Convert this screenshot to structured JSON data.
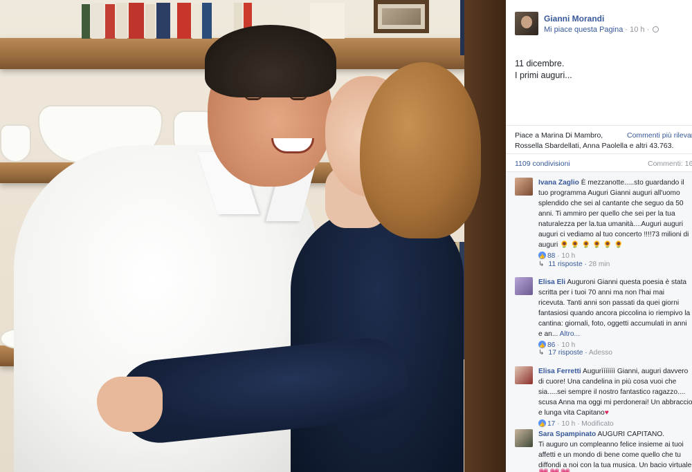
{
  "post": {
    "page_name": "Gianni Morandi",
    "like_page": "Mi piace questa Pagina",
    "time": "10 h",
    "separator": " · ",
    "text_line1": "11 dicembre.",
    "text_line2": "I primi auguri..."
  },
  "likes": {
    "line1": "Piace a Marina Di Mambro,",
    "line2": "Rossella Sbardellati, Anna Paolella e altri 43.763.",
    "top_comments": "Commenti più rilevanti"
  },
  "shares": {
    "count": "1109 condivisioni",
    "comments": "Commenti: 16"
  },
  "comments": [
    {
      "name": "Ivana Zaglio",
      "lines": [
        "È mezzanotte.....sto guardando il",
        "tuo programma Auguri Gianni auguri all'uomo",
        "splendido che sei al cantante che seguo da 50",
        "anni. Ti ammiro per quello che sei per la tua",
        "naturalezza per la.tua umanità....Auguri auguri",
        "auguri ci vediamo al tuo concerto !!!!73 milioni di",
        "auguri"
      ],
      "emoji": "🌻🌻🌻🌻🌻🌻",
      "likes": "88",
      "time": "10 h",
      "replies": "11 risposte",
      "replies_ago": "28 min"
    },
    {
      "name": "Elisa Eli",
      "lines": [
        "Auguroni Gianni questa poesia è stata",
        "scritta per i tuoi 70 anni ma non l'hai mai",
        "ricevuta. Tanti anni son passati da quei giorni",
        "fantasiosi quando ancora piccolina io riempivo la",
        "cantina: giornali, foto, oggetti accumulati in anni",
        "e an..."
      ],
      "more": "Altro...",
      "likes": "86",
      "time": "10 h",
      "replies": "17 risposte",
      "replies_ago": "Adesso"
    },
    {
      "name": "Elisa Ferretti",
      "lines": [
        "Augurììììììì Gianni, auguri davvero",
        "di cuore! Una candelina in più cosa vuoi che",
        "sia.....sei sempre il nostro fantastico ragazzo....",
        "scusa Anna ma oggi mi perdonerai! Un abbraccio",
        "e lunga vita Capitano"
      ],
      "heart": "♥",
      "likes": "17",
      "time": "10 h",
      "edited": "Modificato"
    },
    {
      "name": "Sara Spampinato",
      "lines": [
        "AUGURI CAPITANO.",
        "Ti auguro un compleanno felice insieme ai tuoi",
        "affetti e un mondo di bene come quello che tu",
        "diffondi a noi con la tua musica. Un bacio virtuale"
      ]
    }
  ],
  "bottom_hearts": "💗💗💗",
  "colors": {
    "link": "#365899",
    "meta": "#90949c",
    "text": "#1d2129",
    "panel_bg": "#ffffff",
    "comments_bg": "#f6f7f9"
  }
}
